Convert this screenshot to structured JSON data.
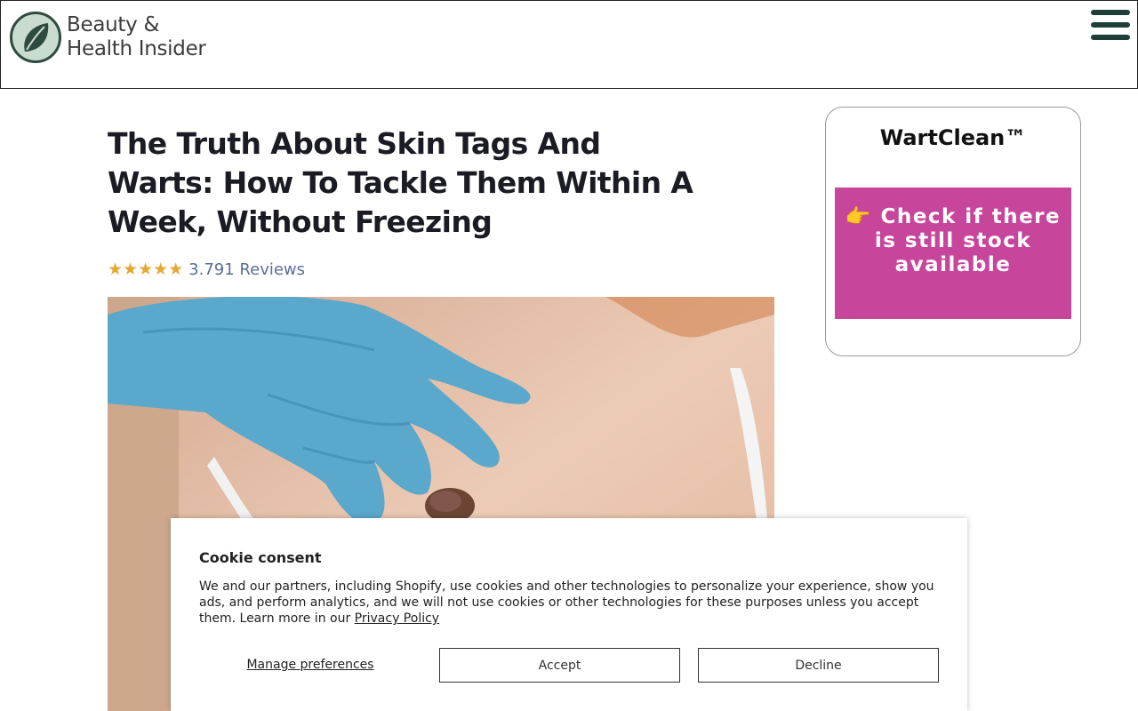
{
  "header": {
    "logo_line1": "Beauty &",
    "logo_line2": "Health Insider",
    "menu_icon": "hamburger-menu-icon"
  },
  "article": {
    "title": "The Truth About Skin Tags And Warts: How To Tackle Them Within A Week, Without Freezing",
    "stars": "★★★★★",
    "reviews": "3.791 Reviews",
    "hero_image": "gloved-hand-examining-skin-tag-photo"
  },
  "sidebar": {
    "product_name": "WartClean™",
    "cta_label": "👉 Check if there is still stock available"
  },
  "cookie": {
    "title": "Cookie consent",
    "body": "We and our partners, including Shopify, use cookies and other technologies to personalize your experience, show you ads, and perform analytics, and we will not use cookies or other technologies for these purposes unless you accept them. Learn more in our ",
    "privacy_link": "Privacy Policy",
    "manage_label": "Manage preferences",
    "accept_label": "Accept",
    "decline_label": "Decline"
  },
  "colors": {
    "brand_green": "#1e3f38",
    "cta_pink": "#c7469c",
    "star_gold": "#e5a833",
    "reviews_blue": "#5a6d9a"
  }
}
